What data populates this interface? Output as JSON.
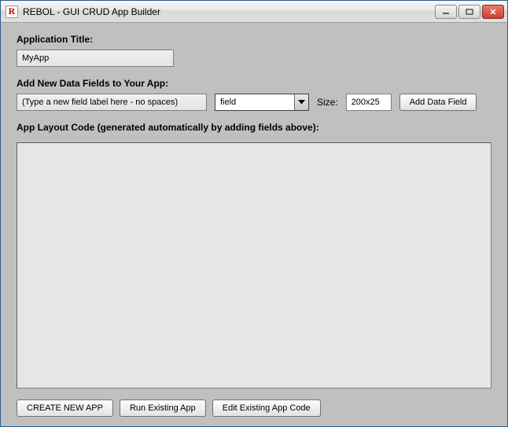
{
  "window": {
    "title": "REBOL - GUI CRUD App Builder",
    "icon_letter": "R"
  },
  "labels": {
    "app_title": "Application Title:",
    "add_fields": "Add New Data Fields to Your App:",
    "layout_code": "App Layout Code (generated automatically by adding fields above):",
    "size": "Size:"
  },
  "inputs": {
    "app_title_value": "MyApp",
    "field_label_placeholder": "(Type a new field label here - no spaces)",
    "field_type_selected": "field",
    "size_value": "200x25",
    "layout_code_value": ""
  },
  "buttons": {
    "add_field": "Add Data Field",
    "create_new": "CREATE NEW APP",
    "run_existing": "Run Existing App",
    "edit_existing": "Edit Existing App Code"
  }
}
